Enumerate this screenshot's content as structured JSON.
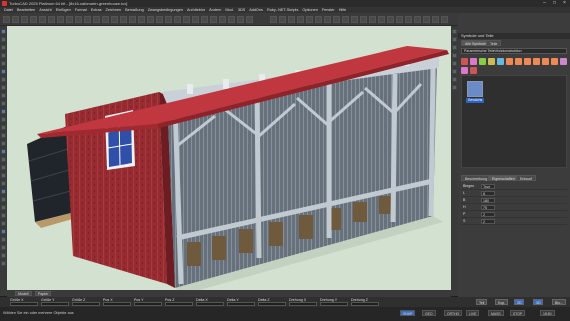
{
  "window": {
    "title": "TurboCAD 2025 Platinum 64 bit - [8x16-cafcmartn-greenhouse.tcx]",
    "controls": {
      "minimize": "–",
      "maximize": "□",
      "close": "×"
    }
  },
  "menu": [
    "Datei",
    "Bearbeiten",
    "Ansicht",
    "Einfügen",
    "Format",
    "Extras",
    "Zeichnen",
    "Bemaßung",
    "Zwangsbedingungen",
    "Architektur",
    "Ändern",
    "Mod.",
    "3DS",
    "AddOns",
    "Ruby-.NET-Skripts",
    "Optionen",
    "Fenster",
    "Hilfe"
  ],
  "panel": {
    "header": "Symbole und Teile",
    "tabs": [
      "Alle Symbole",
      "Teile"
    ],
    "library_path": "Parametrische Teile\\Holzkonstruktion",
    "symbol_label": "Gewächs",
    "prop_tabs": [
      "Beschreibung",
      "Eigenschaften",
      "Entwurf"
    ],
    "props": [
      {
        "key": "Biegen",
        "value": "True"
      },
      {
        "key": "L",
        "value": "8"
      },
      {
        "key": "B",
        "value": "180"
      },
      {
        "key": "H",
        "value": "75"
      },
      {
        "key": "P",
        "value": "2"
      },
      {
        "key": "S",
        "value": "2"
      }
    ]
  },
  "view_tabs": [
    "Modell",
    "Papier"
  ],
  "coords": [
    "Größe X",
    "Größe Y",
    "Größe Z",
    "Pos X",
    "Pos Y",
    "Pos Z",
    "Delta X",
    "Delta Y",
    "Delta Z",
    "Drehung X",
    "Drehung Y",
    "Drehung Z"
  ],
  "coord_buttons": [
    "Teil",
    "Kop.",
    "2D",
    "3D",
    "Blo..."
  ],
  "status": {
    "message": "Wählen Sie ein oder mehrere Objekte aus",
    "buttons": [
      "SNAP",
      "GEO",
      "ORTHO",
      "LIVE",
      "MASS",
      "STOP"
    ],
    "time": "18:50"
  },
  "colors": {
    "viewport_bg": "#d3e2d0",
    "roof": "#c0373f",
    "brick_wall": "#9a2e33",
    "window_glass": "#2f4fa8",
    "frame": "#b8c0c8",
    "water_tank": "#2a2f36",
    "accent_blue": "#3a6fc4"
  }
}
